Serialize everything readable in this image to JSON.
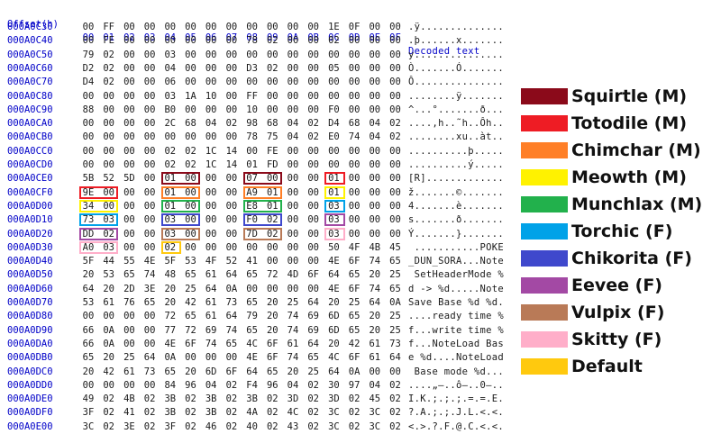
{
  "header": {
    "offset_label": "Offset(h)",
    "columns": [
      "00",
      "01",
      "02",
      "03",
      "04",
      "05",
      "06",
      "07",
      "08",
      "09",
      "0A",
      "0B",
      "0C",
      "0D",
      "0E",
      "0F"
    ],
    "decoded_label": "Decoded text"
  },
  "rows": [
    {
      "offset": "000A0C30",
      "bytes": [
        "00",
        "FF",
        "00",
        "00",
        "00",
        "00",
        "00",
        "00",
        "00",
        "00",
        "00",
        "00",
        "1E",
        "0F",
        "00",
        "00"
      ],
      "decoded": ".ÿ.............."
    },
    {
      "offset": "000A0C40",
      "bytes": [
        "00",
        "FE",
        "00",
        "00",
        "00",
        "00",
        "00",
        "00",
        "78",
        "02",
        "00",
        "00",
        "02",
        "00",
        "00",
        "00"
      ],
      "decoded": ".þ......x......."
    },
    {
      "offset": "000A0C50",
      "bytes": [
        "79",
        "02",
        "00",
        "00",
        "03",
        "00",
        "00",
        "00",
        "00",
        "00",
        "00",
        "00",
        "00",
        "00",
        "00",
        "00"
      ],
      "decoded": "y..............."
    },
    {
      "offset": "000A0C60",
      "bytes": [
        "D2",
        "02",
        "00",
        "00",
        "04",
        "00",
        "00",
        "00",
        "D3",
        "02",
        "00",
        "00",
        "05",
        "00",
        "00",
        "00"
      ],
      "decoded": "Ò.......Ó......."
    },
    {
      "offset": "000A0C70",
      "bytes": [
        "D4",
        "02",
        "00",
        "00",
        "06",
        "00",
        "00",
        "00",
        "00",
        "00",
        "00",
        "00",
        "00",
        "00",
        "00",
        "00"
      ],
      "decoded": "Ô..............."
    },
    {
      "offset": "000A0C80",
      "bytes": [
        "00",
        "00",
        "00",
        "00",
        "03",
        "1A",
        "10",
        "00",
        "FF",
        "00",
        "00",
        "00",
        "00",
        "00",
        "00",
        "00"
      ],
      "decoded": "........ÿ......."
    },
    {
      "offset": "000A0C90",
      "bytes": [
        "88",
        "00",
        "00",
        "00",
        "B0",
        "00",
        "00",
        "00",
        "10",
        "00",
        "00",
        "00",
        "F0",
        "00",
        "00",
        "00"
      ],
      "decoded": "^...°.......ð..."
    },
    {
      "offset": "000A0CA0",
      "bytes": [
        "00",
        "00",
        "00",
        "00",
        "2C",
        "68",
        "04",
        "02",
        "98",
        "68",
        "04",
        "02",
        "D4",
        "68",
        "04",
        "02"
      ],
      "decoded": "....,h..˜h..Ôh.."
    },
    {
      "offset": "000A0CB0",
      "bytes": [
        "00",
        "00",
        "00",
        "00",
        "00",
        "00",
        "00",
        "00",
        "78",
        "75",
        "04",
        "02",
        "E0",
        "74",
        "04",
        "02"
      ],
      "decoded": "........xu..àt.."
    },
    {
      "offset": "000A0CC0",
      "bytes": [
        "00",
        "00",
        "00",
        "00",
        "02",
        "02",
        "1C",
        "14",
        "00",
        "FE",
        "00",
        "00",
        "00",
        "00",
        "00",
        "00"
      ],
      "decoded": "..........þ....."
    },
    {
      "offset": "000A0CD0",
      "bytes": [
        "00",
        "00",
        "00",
        "00",
        "02",
        "02",
        "1C",
        "14",
        "01",
        "FD",
        "00",
        "00",
        "00",
        "00",
        "00",
        "00"
      ],
      "decoded": "..........ý....."
    },
    {
      "offset": "000A0CE0",
      "bytes": [
        "5B",
        "52",
        "5D",
        "00",
        "01",
        "00",
        "00",
        "00",
        "07",
        "00",
        "00",
        "00",
        "01",
        "00",
        "00",
        "00"
      ],
      "decoded": "[R]............."
    },
    {
      "offset": "000A0CF0",
      "bytes": [
        "9E",
        "00",
        "00",
        "00",
        "01",
        "00",
        "00",
        "00",
        "A9",
        "01",
        "00",
        "00",
        "01",
        "00",
        "00",
        "00"
      ],
      "decoded": "ž.......©......."
    },
    {
      "offset": "000A0D00",
      "bytes": [
        "34",
        "00",
        "00",
        "00",
        "01",
        "00",
        "00",
        "00",
        "E8",
        "01",
        "00",
        "00",
        "03",
        "00",
        "00",
        "00"
      ],
      "decoded": "4.......è......."
    },
    {
      "offset": "000A0D10",
      "bytes": [
        "73",
        "03",
        "00",
        "00",
        "03",
        "00",
        "00",
        "00",
        "F0",
        "02",
        "00",
        "00",
        "03",
        "00",
        "00",
        "00"
      ],
      "decoded": "s.......ð......."
    },
    {
      "offset": "000A0D20",
      "bytes": [
        "DD",
        "02",
        "00",
        "00",
        "03",
        "00",
        "00",
        "00",
        "7D",
        "02",
        "00",
        "00",
        "03",
        "00",
        "00",
        "00"
      ],
      "decoded": "Ý.......}......."
    },
    {
      "offset": "000A0D30",
      "bytes": [
        "A0",
        "03",
        "00",
        "00",
        "02",
        "00",
        "00",
        "00",
        "00",
        "00",
        "00",
        "00",
        "50",
        "4F",
        "4B",
        "45"
      ],
      "decoded": " ...........POKE"
    },
    {
      "offset": "000A0D40",
      "bytes": [
        "5F",
        "44",
        "55",
        "4E",
        "5F",
        "53",
        "4F",
        "52",
        "41",
        "00",
        "00",
        "00",
        "4E",
        "6F",
        "74",
        "65"
      ],
      "decoded": "_DUN_SORA...Note"
    },
    {
      "offset": "000A0D50",
      "bytes": [
        "20",
        "53",
        "65",
        "74",
        "48",
        "65",
        "61",
        "64",
        "65",
        "72",
        "4D",
        "6F",
        "64",
        "65",
        "20",
        "25"
      ],
      "decoded": " SetHeaderMode %"
    },
    {
      "offset": "000A0D60",
      "bytes": [
        "64",
        "20",
        "2D",
        "3E",
        "20",
        "25",
        "64",
        "0A",
        "00",
        "00",
        "00",
        "00",
        "4E",
        "6F",
        "74",
        "65"
      ],
      "decoded": "d -> %d.....Note"
    },
    {
      "offset": "000A0D70",
      "bytes": [
        "53",
        "61",
        "76",
        "65",
        "20",
        "42",
        "61",
        "73",
        "65",
        "20",
        "25",
        "64",
        "20",
        "25",
        "64",
        "0A"
      ],
      "decoded": "Save Base %d %d."
    },
    {
      "offset": "000A0D80",
      "bytes": [
        "00",
        "00",
        "00",
        "00",
        "72",
        "65",
        "61",
        "64",
        "79",
        "20",
        "74",
        "69",
        "6D",
        "65",
        "20",
        "25"
      ],
      "decoded": "....ready time %"
    },
    {
      "offset": "000A0D90",
      "bytes": [
        "66",
        "0A",
        "00",
        "00",
        "77",
        "72",
        "69",
        "74",
        "65",
        "20",
        "74",
        "69",
        "6D",
        "65",
        "20",
        "25"
      ],
      "decoded": "f...write time %"
    },
    {
      "offset": "000A0DA0",
      "bytes": [
        "66",
        "0A",
        "00",
        "00",
        "4E",
        "6F",
        "74",
        "65",
        "4C",
        "6F",
        "61",
        "64",
        "20",
        "42",
        "61",
        "73"
      ],
      "decoded": "f...NoteLoad Bas"
    },
    {
      "offset": "000A0DB0",
      "bytes": [
        "65",
        "20",
        "25",
        "64",
        "0A",
        "00",
        "00",
        "00",
        "4E",
        "6F",
        "74",
        "65",
        "4C",
        "6F",
        "61",
        "64"
      ],
      "decoded": "e %d....NoteLoad"
    },
    {
      "offset": "000A0DC0",
      "bytes": [
        "20",
        "42",
        "61",
        "73",
        "65",
        "20",
        "6D",
        "6F",
        "64",
        "65",
        "20",
        "25",
        "64",
        "0A",
        "00",
        "00"
      ],
      "decoded": " Base mode %d..."
    },
    {
      "offset": "000A0DD0",
      "bytes": [
        "00",
        "00",
        "00",
        "00",
        "84",
        "96",
        "04",
        "02",
        "F4",
        "96",
        "04",
        "02",
        "30",
        "97",
        "04",
        "02"
      ],
      "decoded": "....„–..ô–..0—.."
    },
    {
      "offset": "000A0DE0",
      "bytes": [
        "49",
        "02",
        "4B",
        "02",
        "3B",
        "02",
        "3B",
        "02",
        "3B",
        "02",
        "3D",
        "02",
        "3D",
        "02",
        "45",
        "02"
      ],
      "decoded": "I.K.;.;.;.=.=.E."
    },
    {
      "offset": "000A0DF0",
      "bytes": [
        "3F",
        "02",
        "41",
        "02",
        "3B",
        "02",
        "3B",
        "02",
        "4A",
        "02",
        "4C",
        "02",
        "3C",
        "02",
        "3C",
        "02"
      ],
      "decoded": "?.A.;.;.J.L.<.<."
    },
    {
      "offset": "000A0E00",
      "bytes": [
        "3C",
        "02",
        "3E",
        "02",
        "3F",
        "02",
        "46",
        "02",
        "40",
        "02",
        "43",
        "02",
        "3C",
        "02",
        "3C",
        "02"
      ],
      "decoded": "<.>.?.F.@.C.<.<."
    }
  ],
  "legend": [
    {
      "label": "Squirtle (M)",
      "color": "#8b0a1a"
    },
    {
      "label": "Totodile (M)",
      "color": "#ee1c24"
    },
    {
      "label": "Chimchar (M)",
      "color": "#ff7f27"
    },
    {
      "label": "Meowth (M)",
      "color": "#fff200"
    },
    {
      "label": "Munchlax (M)",
      "color": "#22b14c"
    },
    {
      "label": "Torchic (F)",
      "color": "#00a2e8"
    },
    {
      "label": "Chikorita (F)",
      "color": "#3f48cc"
    },
    {
      "label": "Eevee (F)",
      "color": "#a349a4"
    },
    {
      "label": "Vulpix (F)",
      "color": "#b97a57"
    },
    {
      "label": "Skitty (F)",
      "color": "#ffaec9"
    },
    {
      "label": "Default",
      "color": "#ffc90e"
    }
  ],
  "highlights": [
    {
      "row": 11,
      "col": 4,
      "span": 2,
      "color": "#8b0a1a"
    },
    {
      "row": 11,
      "col": 8,
      "span": 2,
      "color": "#8b0a1a"
    },
    {
      "row": 11,
      "col": 12,
      "span": 1,
      "color": "#ee1c24"
    },
    {
      "row": 12,
      "col": 0,
      "span": 2,
      "color": "#ee1c24"
    },
    {
      "row": 12,
      "col": 4,
      "span": 2,
      "color": "#ff7f27"
    },
    {
      "row": 12,
      "col": 8,
      "span": 2,
      "color": "#ff7f27"
    },
    {
      "row": 12,
      "col": 12,
      "span": 1,
      "color": "#fff200"
    },
    {
      "row": 13,
      "col": 0,
      "span": 2,
      "color": "#fff200"
    },
    {
      "row": 13,
      "col": 4,
      "span": 2,
      "color": "#22b14c"
    },
    {
      "row": 13,
      "col": 8,
      "span": 2,
      "color": "#22b14c"
    },
    {
      "row": 13,
      "col": 12,
      "span": 1,
      "color": "#00a2e8"
    },
    {
      "row": 14,
      "col": 0,
      "span": 2,
      "color": "#00a2e8"
    },
    {
      "row": 14,
      "col": 4,
      "span": 2,
      "color": "#3f48cc"
    },
    {
      "row": 14,
      "col": 8,
      "span": 2,
      "color": "#3f48cc"
    },
    {
      "row": 14,
      "col": 12,
      "span": 1,
      "color": "#a349a4"
    },
    {
      "row": 15,
      "col": 0,
      "span": 2,
      "color": "#a349a4"
    },
    {
      "row": 15,
      "col": 4,
      "span": 2,
      "color": "#b97a57"
    },
    {
      "row": 15,
      "col": 8,
      "span": 2,
      "color": "#b97a57"
    },
    {
      "row": 15,
      "col": 12,
      "span": 1,
      "color": "#ffaec9"
    },
    {
      "row": 16,
      "col": 0,
      "span": 2,
      "color": "#ffaec9"
    },
    {
      "row": 16,
      "col": 4,
      "span": 1,
      "color": "#ffc90e"
    }
  ]
}
